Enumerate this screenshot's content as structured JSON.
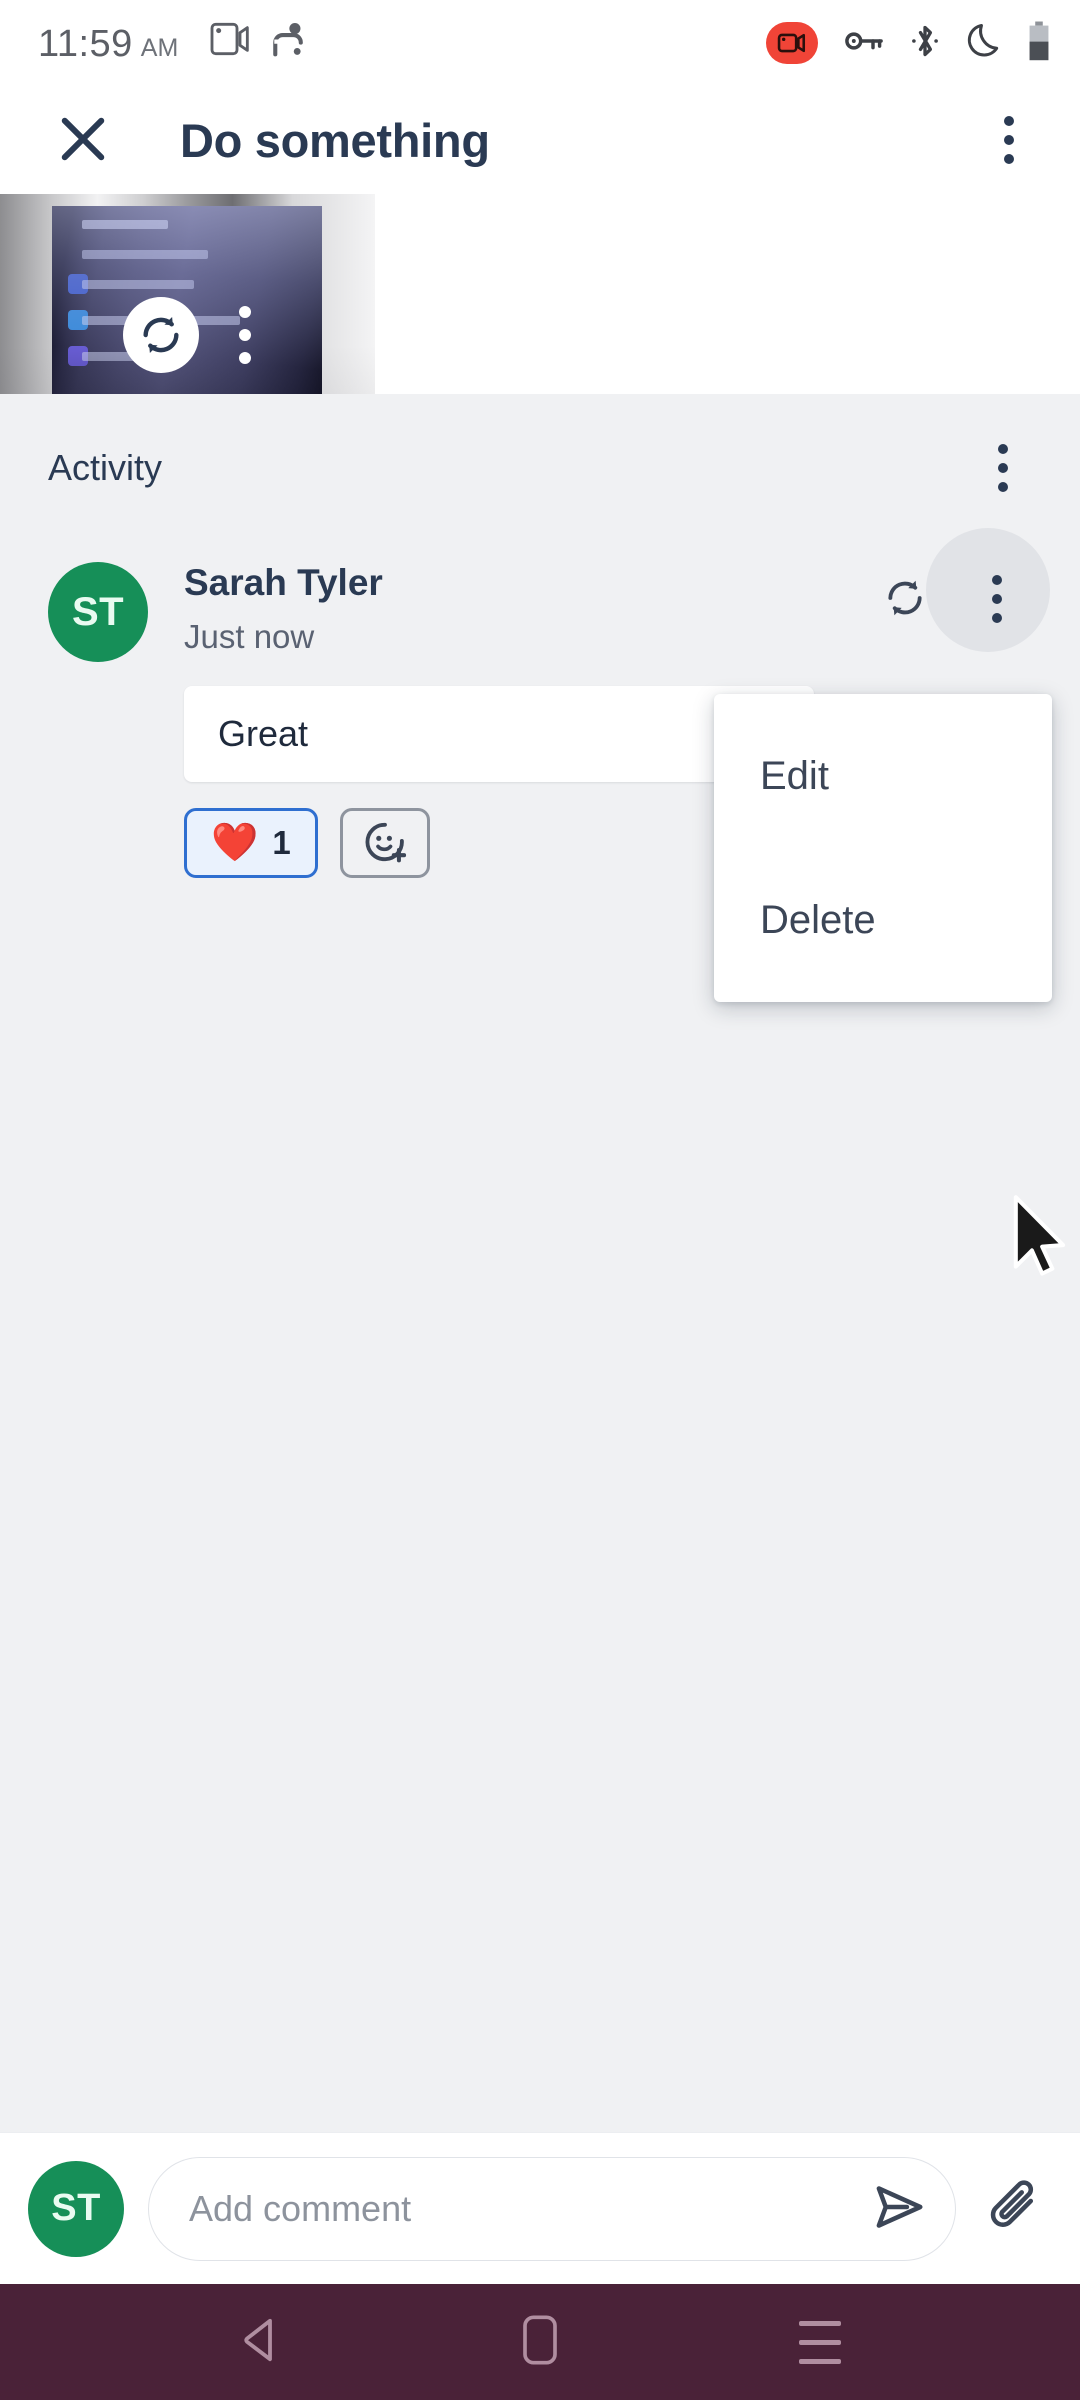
{
  "status_bar": {
    "time": "11:59",
    "ampm": "AM",
    "left_icons": [
      "cast-screen-icon",
      "screen-record-cast-icon"
    ],
    "right_icons": [
      "screen-recording-active-icon",
      "vpn-key-icon",
      "bluetooth-icon",
      "do-not-disturb-moon-icon",
      "battery-icon"
    ],
    "recording_color": "#f04437"
  },
  "app_bar": {
    "close_label": "close-icon",
    "title": "Do something",
    "overflow_label": "more-options-icon"
  },
  "attachment": {
    "name": "photo-attachment-thumbnail",
    "retry_label": "retry-upload-icon",
    "menu_label": "attachment-more-options-icon"
  },
  "activity": {
    "title": "Activity",
    "overflow_label": "activity-more-options-icon",
    "comment": {
      "avatar_initials": "ST",
      "avatar_color": "#168f58",
      "author": "Sarah Tyler",
      "timestamp": "Just now",
      "text": "Great",
      "retry_label": "retry-send-icon",
      "overflow_label": "comment-more-options-icon",
      "reactions": [
        {
          "emoji": "❤️",
          "count": "1",
          "selected": true,
          "name": "heart-reaction"
        },
        {
          "emoji": "",
          "count": "",
          "selected": false,
          "name": "add-reaction"
        }
      ]
    }
  },
  "context_menu": {
    "items": [
      {
        "label": "Edit",
        "name": "menu-item-edit"
      },
      {
        "label": "Delete",
        "name": "menu-item-delete"
      }
    ]
  },
  "composer": {
    "avatar_initials": "ST",
    "placeholder": "Add comment",
    "value": "",
    "send_label": "send-icon",
    "attach_label": "attach-paperclip-icon"
  },
  "nav_bar": {
    "background": "#4a2238",
    "back_label": "back-icon",
    "home_label": "home-icon",
    "recents_label": "recents-icon"
  },
  "colors": {
    "page_background": "#ffffff",
    "activity_background": "#f0f1f3",
    "text_primary": "#2a3a53",
    "accent_blue": "#2f6fd0"
  }
}
